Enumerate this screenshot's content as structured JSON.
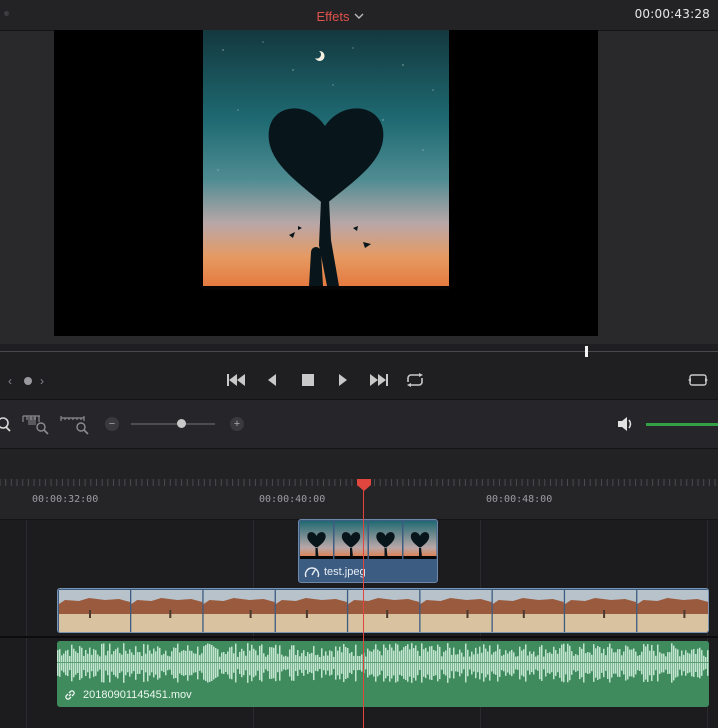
{
  "header": {
    "panel_title": "Effets",
    "dropdown_icon": "chevron-down-icon",
    "timecode": "00:00:43:28"
  },
  "viewer": {
    "image_description_icon": "tree-heart-silhouette",
    "scrubber_position": 0.816
  },
  "transport": {
    "buttons": [
      "skip-to-start-icon",
      "step-back-icon",
      "stop-icon",
      "play-icon",
      "skip-to-end-icon",
      "loop-icon"
    ],
    "nav_left": "‹",
    "nav_right": "›"
  },
  "zoom_toolbar": {
    "zoom_minus": "−",
    "zoom_plus": "+",
    "zoom_level": 0.62,
    "volume_level": 1.0
  },
  "ruler": {
    "labels": [
      "00:00:32:00",
      "00:00:40:00",
      "00:00:48:00"
    ]
  },
  "clips": {
    "still": {
      "name": "test.jpeg",
      "icon": "speed-gauge-icon"
    },
    "audio": {
      "name": "20180901145451.mov",
      "icon": "link-icon"
    }
  },
  "colors": {
    "accent_red": "#e0463e",
    "video_clip": "#3d5c82",
    "audio_clip": "#3f8b5d",
    "volume": "#34a046"
  }
}
